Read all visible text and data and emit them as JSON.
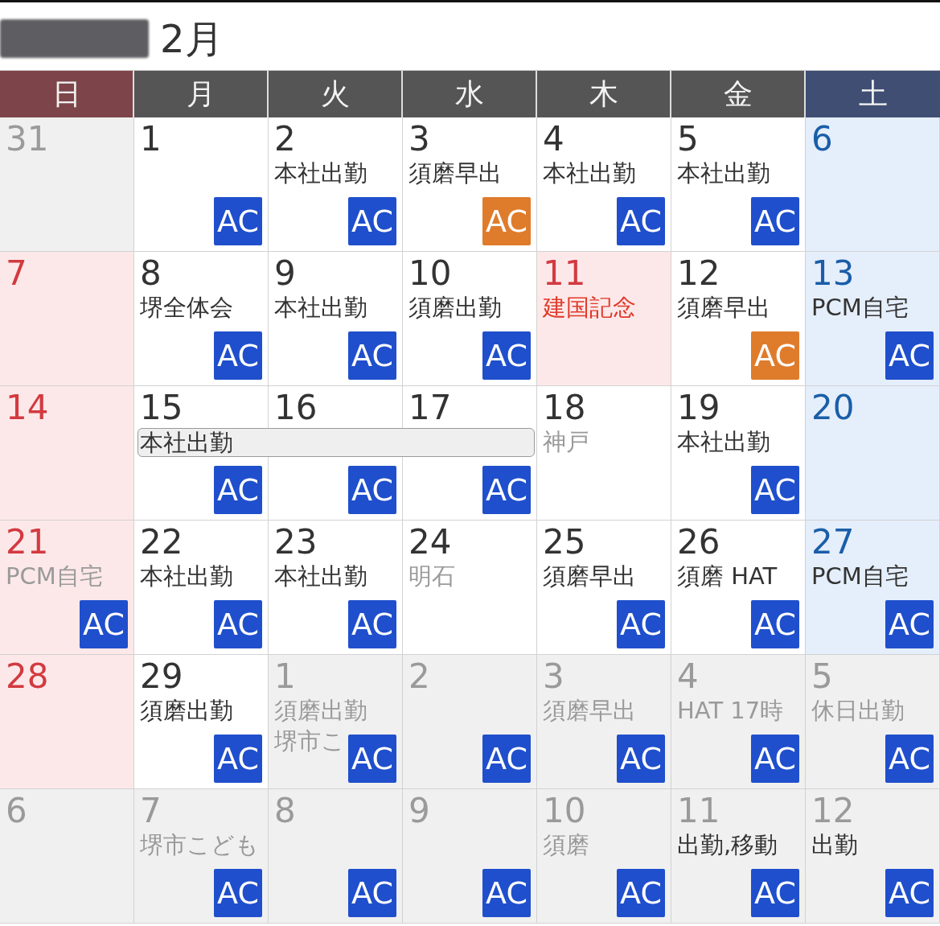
{
  "title": {
    "text": "2月"
  },
  "weekdays": [
    {
      "label": "日",
      "kind": "sunday"
    },
    {
      "label": "月",
      "kind": "weekday"
    },
    {
      "label": "火",
      "kind": "weekday"
    },
    {
      "label": "水",
      "kind": "weekday"
    },
    {
      "label": "木",
      "kind": "weekday"
    },
    {
      "label": "金",
      "kind": "weekday"
    },
    {
      "label": "土",
      "kind": "saturday"
    }
  ],
  "weeks": [
    {
      "days": [
        {
          "day": "31",
          "other_month": true
        },
        {
          "day": "1",
          "kind": "weekday",
          "other_month": false,
          "badge": {
            "text": "AC",
            "color": "#1f4fcc"
          }
        },
        {
          "day": "2",
          "kind": "weekday",
          "other_month": false,
          "events": [
            {
              "text": "本社出勤",
              "kind": "normal"
            }
          ],
          "badge": {
            "text": "AC",
            "color": "#1f4fcc"
          }
        },
        {
          "day": "3",
          "kind": "weekday",
          "other_month": false,
          "events": [
            {
              "text": "須磨早出",
              "kind": "normal"
            }
          ],
          "badge": {
            "text": "AC",
            "color": "#df7c2c"
          }
        },
        {
          "day": "4",
          "kind": "weekday",
          "other_month": false,
          "events": [
            {
              "text": "本社出勤",
              "kind": "normal"
            }
          ],
          "badge": {
            "text": "AC",
            "color": "#1f4fcc"
          }
        },
        {
          "day": "5",
          "kind": "weekday",
          "other_month": false,
          "events": [
            {
              "text": "本社出勤",
              "kind": "normal"
            }
          ],
          "badge": {
            "text": "AC",
            "color": "#1f4fcc"
          }
        },
        {
          "day": "6",
          "kind": "saturday",
          "other_month": false
        }
      ]
    },
    {
      "days": [
        {
          "day": "7",
          "kind": "sunday",
          "other_month": false
        },
        {
          "day": "8",
          "kind": "weekday",
          "other_month": false,
          "events": [
            {
              "text": "堺全体会",
              "kind": "normal"
            }
          ],
          "badge": {
            "text": "AC",
            "color": "#1f4fcc"
          }
        },
        {
          "day": "9",
          "kind": "weekday",
          "other_month": false,
          "events": [
            {
              "text": "本社出勤",
              "kind": "normal"
            }
          ],
          "badge": {
            "text": "AC",
            "color": "#1f4fcc"
          }
        },
        {
          "day": "10",
          "kind": "weekday",
          "other_month": false,
          "events": [
            {
              "text": "須磨出勤",
              "kind": "normal"
            }
          ],
          "badge": {
            "text": "AC",
            "color": "#1f4fcc"
          }
        },
        {
          "day": "11",
          "kind": "holiday",
          "other_month": false,
          "events": [
            {
              "text": "建国記念",
              "kind": "holiday"
            }
          ]
        },
        {
          "day": "12",
          "kind": "weekday",
          "other_month": false,
          "events": [
            {
              "text": "須磨早出",
              "kind": "normal"
            }
          ],
          "badge": {
            "text": "AC",
            "color": "#df7c2c"
          }
        },
        {
          "day": "13",
          "kind": "saturday",
          "other_month": false,
          "events": [
            {
              "text": "PCM自宅",
              "kind": "normal"
            }
          ],
          "badge": {
            "text": "AC",
            "color": "#1f4fcc"
          }
        }
      ]
    },
    {
      "days": [
        {
          "day": "14",
          "kind": "sunday",
          "other_month": false
        },
        {
          "day": "15",
          "kind": "weekday",
          "other_month": false,
          "bar": {
            "text": "本社出勤"
          },
          "badge": {
            "text": "AC",
            "color": "#1f4fcc"
          }
        },
        {
          "day": "16",
          "kind": "weekday",
          "other_month": false,
          "bar_continues": true,
          "badge": {
            "text": "AC",
            "color": "#1f4fcc"
          }
        },
        {
          "day": "17",
          "kind": "weekday",
          "other_month": false,
          "bar_continues": true,
          "badge": {
            "text": "AC",
            "color": "#1f4fcc"
          }
        },
        {
          "day": "18",
          "kind": "weekday",
          "other_month": false,
          "events": [
            {
              "text": "神戸",
              "kind": "faded"
            }
          ]
        },
        {
          "day": "19",
          "kind": "weekday",
          "other_month": false,
          "events": [
            {
              "text": "本社出勤",
              "kind": "normal"
            }
          ],
          "badge": {
            "text": "AC",
            "color": "#1f4fcc"
          }
        },
        {
          "day": "20",
          "kind": "saturday",
          "other_month": false
        }
      ]
    },
    {
      "days": [
        {
          "day": "21",
          "kind": "sunday",
          "other_month": false,
          "events": [
            {
              "text": "PCM自宅",
              "kind": "faded"
            }
          ],
          "badge": {
            "text": "AC",
            "color": "#1f4fcc"
          }
        },
        {
          "day": "22",
          "kind": "weekday",
          "other_month": false,
          "events": [
            {
              "text": "本社出勤",
              "kind": "normal"
            }
          ],
          "badge": {
            "text": "AC",
            "color": "#1f4fcc"
          }
        },
        {
          "day": "23",
          "kind": "weekday",
          "other_month": false,
          "events": [
            {
              "text": "本社出勤",
              "kind": "normal"
            }
          ],
          "badge": {
            "text": "AC",
            "color": "#1f4fcc"
          }
        },
        {
          "day": "24",
          "kind": "weekday",
          "other_month": false,
          "events": [
            {
              "text": "明石",
              "kind": "faded"
            }
          ]
        },
        {
          "day": "25",
          "kind": "weekday",
          "other_month": false,
          "events": [
            {
              "text": "須磨早出",
              "kind": "normal"
            }
          ],
          "badge": {
            "text": "AC",
            "color": "#1f4fcc"
          }
        },
        {
          "day": "26",
          "kind": "weekday",
          "other_month": false,
          "events": [
            {
              "text": "須磨 HAT",
              "kind": "normal"
            }
          ],
          "badge": {
            "text": "AC",
            "color": "#1f4fcc"
          }
        },
        {
          "day": "27",
          "kind": "saturday",
          "other_month": false,
          "events": [
            {
              "text": "PCM自宅",
              "kind": "normal"
            }
          ],
          "badge": {
            "text": "AC",
            "color": "#1f4fcc"
          }
        }
      ]
    },
    {
      "days": [
        {
          "day": "28",
          "kind": "sunday",
          "other_month": false
        },
        {
          "day": "29",
          "kind": "weekday",
          "other_month": false,
          "events": [
            {
              "text": "須磨出勤",
              "kind": "normal"
            }
          ],
          "badge": {
            "text": "AC",
            "color": "#1f4fcc"
          }
        },
        {
          "day": "1",
          "other_month": true,
          "events": [
            {
              "text": "須磨出勤",
              "kind": "faded"
            },
            {
              "text": "堺市こ",
              "kind": "faded"
            }
          ],
          "badge": {
            "text": "AC",
            "color": "#1f4fcc"
          }
        },
        {
          "day": "2",
          "other_month": true,
          "badge": {
            "text": "AC",
            "color": "#1f4fcc"
          }
        },
        {
          "day": "3",
          "other_month": true,
          "events": [
            {
              "text": "須磨早出",
              "kind": "faded"
            }
          ],
          "badge": {
            "text": "AC",
            "color": "#1f4fcc"
          }
        },
        {
          "day": "4",
          "other_month": true,
          "events": [
            {
              "text": "HAT 17時",
              "kind": "faded"
            }
          ],
          "badge": {
            "text": "AC",
            "color": "#1f4fcc"
          }
        },
        {
          "day": "5",
          "other_month": true,
          "events": [
            {
              "text": "休日出勤",
              "kind": "faded"
            }
          ],
          "badge": {
            "text": "AC",
            "color": "#1f4fcc"
          }
        }
      ]
    },
    {
      "days": [
        {
          "day": "6",
          "other_month": true
        },
        {
          "day": "7",
          "other_month": true,
          "events": [
            {
              "text": "堺市こども",
              "kind": "faded"
            }
          ],
          "badge": {
            "text": "AC",
            "color": "#1f4fcc"
          }
        },
        {
          "day": "8",
          "other_month": true,
          "badge": {
            "text": "AC",
            "color": "#1f4fcc"
          }
        },
        {
          "day": "9",
          "other_month": true,
          "badge": {
            "text": "AC",
            "color": "#1f4fcc"
          }
        },
        {
          "day": "10",
          "other_month": true,
          "events": [
            {
              "text": "須磨",
              "kind": "faded"
            }
          ],
          "badge": {
            "text": "AC",
            "color": "#1f4fcc"
          }
        },
        {
          "day": "11",
          "other_month": true,
          "events": [
            {
              "text": "出勤,移動",
              "kind": "normal"
            }
          ],
          "badge": {
            "text": "AC",
            "color": "#1f4fcc"
          }
        },
        {
          "day": "12",
          "other_month": true,
          "events": [
            {
              "text": "出勤",
              "kind": "normal"
            }
          ],
          "badge": {
            "text": "AC",
            "color": "#1f4fcc"
          }
        }
      ]
    }
  ]
}
